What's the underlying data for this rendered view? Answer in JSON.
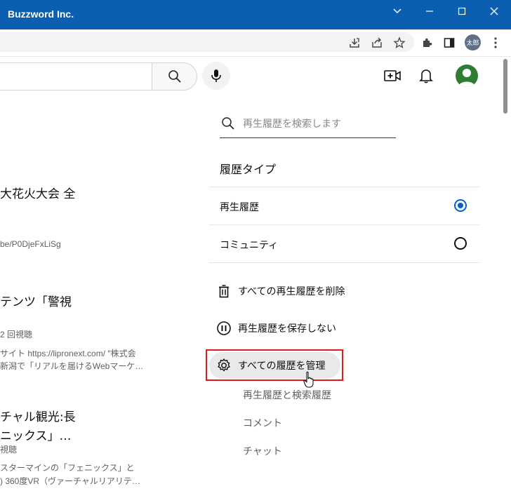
{
  "window": {
    "title": "Buzzword Inc."
  },
  "browser": {
    "profile_label": "太郎"
  },
  "videos": [
    {
      "title": "大花火大会 全",
      "meta": "be/P0DjeFxLiSg"
    },
    {
      "title": "テンツ「警視",
      "meta": "2 回視聴",
      "desc1": "サイト https://lipronext.com/ \"株式会",
      "desc2": "新潟で「リアルを届けるWebマーケ…"
    },
    {
      "title": "チャル観光:長",
      "title2": "ニックス」…",
      "meta": "視聴",
      "desc1": "スターマインの「フェニックス」と",
      "desc2": ") 360度VR（ヴァーチャルリアリテ…"
    }
  ],
  "history_panel": {
    "search_placeholder": "再生履歴を検索します",
    "type_heading": "履歴タイプ",
    "types": [
      {
        "label": "再生履歴",
        "selected": true
      },
      {
        "label": "コミュニティ",
        "selected": false
      }
    ],
    "actions": [
      {
        "label": "すべての再生履歴を削除",
        "icon": "trash-icon"
      },
      {
        "label": "再生履歴を保存しない",
        "icon": "pause-icon"
      },
      {
        "label": "すべての履歴を管理",
        "icon": "gear-icon"
      }
    ],
    "sub_links": [
      "再生履歴と検索履歴",
      "コメント",
      "チャット"
    ]
  },
  "colors": {
    "titlebar": "#0b5fb0",
    "accent": "#065fd4",
    "highlight": "#e01b1b"
  }
}
